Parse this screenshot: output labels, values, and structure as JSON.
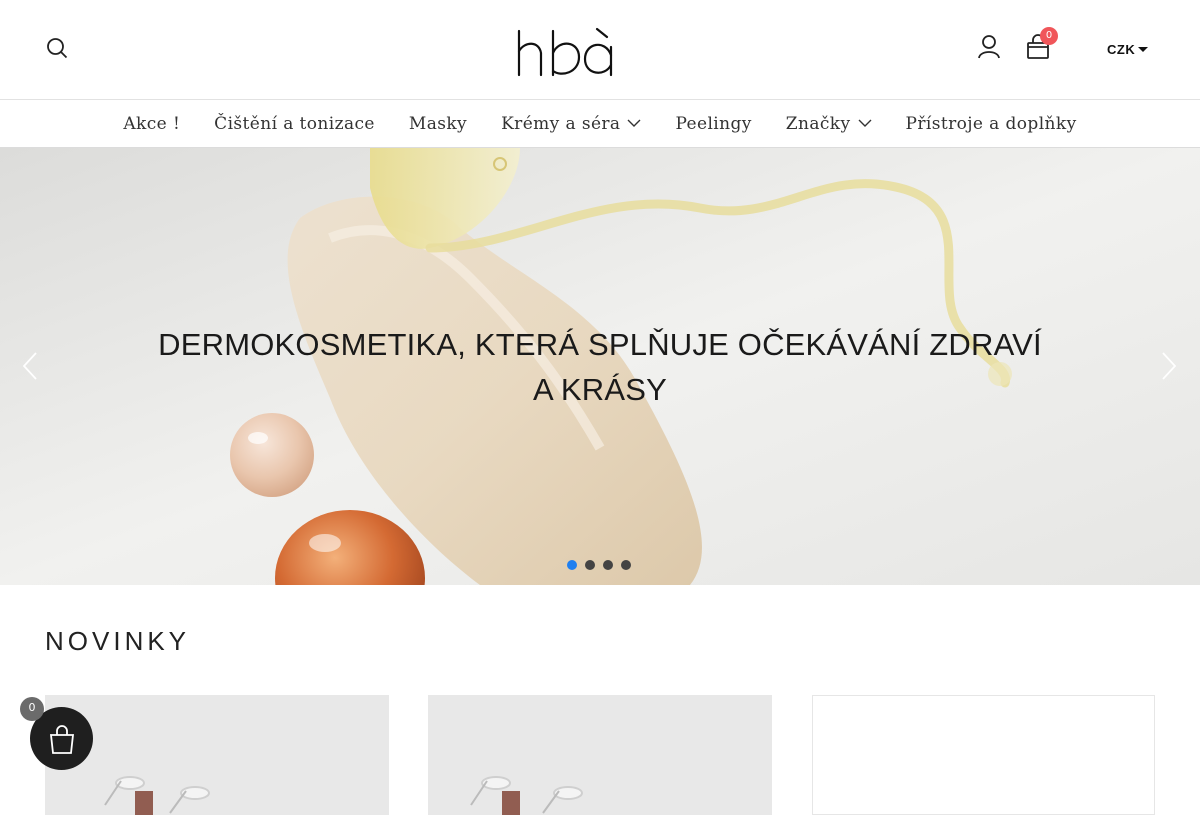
{
  "header": {
    "logo_text": "hbá",
    "cart_count": "0",
    "currency": "CZK",
    "icons": [
      "search-icon",
      "user-icon",
      "shopping-bag-icon",
      "caret-down-icon"
    ]
  },
  "nav": {
    "items": [
      {
        "label": "Akce !",
        "has_dropdown": false
      },
      {
        "label": "Čištění a tonizace",
        "has_dropdown": false
      },
      {
        "label": "Masky",
        "has_dropdown": false
      },
      {
        "label": "Krémy a séra",
        "has_dropdown": true
      },
      {
        "label": "Peelingy",
        "has_dropdown": false
      },
      {
        "label": "Značky",
        "has_dropdown": true
      },
      {
        "label": "Přístroje a doplňky",
        "has_dropdown": false
      }
    ]
  },
  "hero": {
    "title": "DERMOKOSMETIKA, KTERÁ SPLŇUJE OČEKÁVÁNÍ ZDRAVÍ A KRÁSY",
    "slides_total": 4,
    "active_slide": 1,
    "active_dot_color": "#1f7ff0"
  },
  "new_products": {
    "title": "NOVINKY"
  },
  "floating_cart": {
    "count": "0"
  },
  "colors": {
    "badge_red": "#f0565a",
    "accent_blue": "#1f7ff0",
    "dark": "#1f1f1f"
  }
}
